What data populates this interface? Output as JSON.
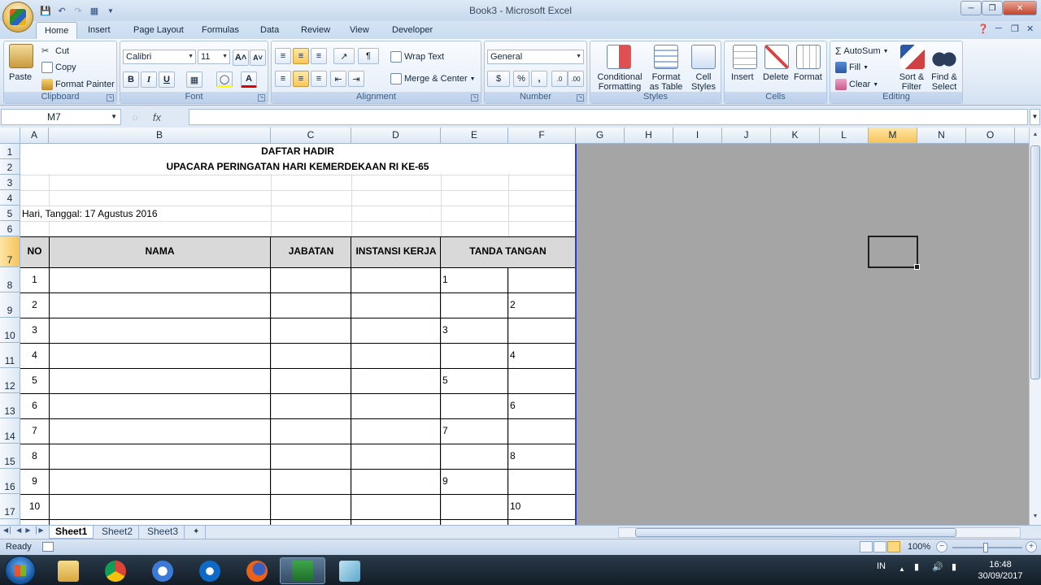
{
  "window": {
    "title": "Book3 - Microsoft Excel"
  },
  "ribbon_tabs": [
    "Home",
    "Insert",
    "Page Layout",
    "Formulas",
    "Data",
    "Review",
    "View",
    "Developer"
  ],
  "ribbon": {
    "clipboard": {
      "label": "Clipboard",
      "paste": "Paste",
      "cut": "Cut",
      "copy": "Copy",
      "format_painter": "Format Painter"
    },
    "font": {
      "label": "Font",
      "font_name": "Calibri",
      "font_size": "11",
      "bold": "B",
      "italic": "I",
      "underline": "U"
    },
    "alignment": {
      "label": "Alignment",
      "wrap_text": "Wrap Text",
      "merge_center": "Merge & Center"
    },
    "number": {
      "label": "Number",
      "format": "General",
      "percent": "%",
      "comma": ","
    },
    "styles": {
      "label": "Styles",
      "conditional_1": "Conditional",
      "conditional_2": "Formatting",
      "format_table_1": "Format",
      "format_table_2": "as Table",
      "cell_styles_1": "Cell",
      "cell_styles_2": "Styles"
    },
    "cells": {
      "label": "Cells",
      "insert": "Insert",
      "delete": "Delete",
      "format": "Format"
    },
    "editing": {
      "label": "Editing",
      "autosum": "AutoSum",
      "fill": "Fill",
      "clear": "Clear",
      "sort_1": "Sort &",
      "sort_2": "Filter",
      "find_1": "Find &",
      "find_2": "Select"
    }
  },
  "formula_bar": {
    "name_box": "M7",
    "fx": "fx",
    "formula": ""
  },
  "columns": [
    "A",
    "B",
    "C",
    "D",
    "E",
    "F",
    "G",
    "H",
    "I",
    "J",
    "K",
    "L",
    "M",
    "N",
    "O"
  ],
  "selected_column": "M",
  "selected_row": "7",
  "rows": [
    "1",
    "2",
    "3",
    "4",
    "5",
    "6",
    "7",
    "8",
    "9",
    "10",
    "11",
    "12",
    "13",
    "14",
    "15",
    "16",
    "17"
  ],
  "sheet": {
    "title": "DAFTAR HADIR",
    "subtitle": "UPACARA PERINGATAN HARI KEMERDEKAAN RI KE-65",
    "date_line": "Hari, Tanggal: 17 Agustus 2016",
    "headers": {
      "no": "NO",
      "nama": "NAMA",
      "jabatan": "JABATAN",
      "instansi": "INSTANSI KERJA",
      "tanda_tangan": "TANDA TANGAN"
    },
    "entries": [
      {
        "no": "1",
        "sign": "1",
        "col": "E"
      },
      {
        "no": "2",
        "sign": "2",
        "col": "F"
      },
      {
        "no": "3",
        "sign": "3",
        "col": "E"
      },
      {
        "no": "4",
        "sign": "4",
        "col": "F"
      },
      {
        "no": "5",
        "sign": "5",
        "col": "E"
      },
      {
        "no": "6",
        "sign": "6",
        "col": "F"
      },
      {
        "no": "7",
        "sign": "7",
        "col": "E"
      },
      {
        "no": "8",
        "sign": "8",
        "col": "F"
      },
      {
        "no": "9",
        "sign": "9",
        "col": "E"
      },
      {
        "no": "10",
        "sign": "10",
        "col": "F"
      }
    ]
  },
  "sheet_tabs": [
    "Sheet1",
    "Sheet2",
    "Sheet3"
  ],
  "active_sheet": "Sheet1",
  "status": {
    "ready": "Ready",
    "zoom": "100%"
  },
  "taskbar": {
    "language": "IN",
    "time": "16:48",
    "date": "30/09/2017"
  },
  "colors": {
    "header_fill": "#d9d9d9",
    "selection": "#f6c45a",
    "page_break": "#2b3fbf"
  }
}
